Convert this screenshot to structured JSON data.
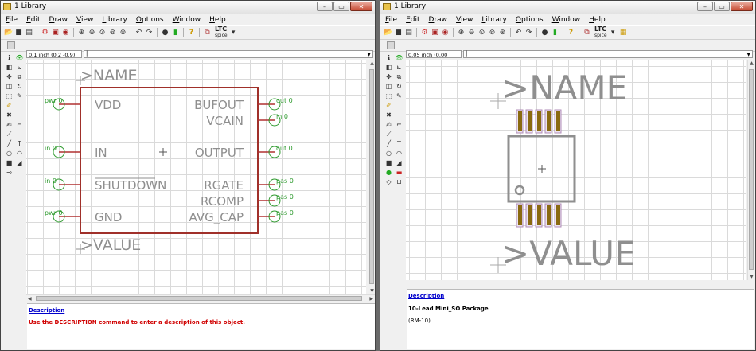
{
  "colors": {
    "grid": "#dadada",
    "outline": "#a0302a",
    "pin": "#b03030",
    "pin_circle": "#2e9a2e",
    "text_gray": "#8f8f8f",
    "pad": "#8a6a10",
    "link": "#0000cc",
    "warn": "#d00000"
  },
  "left_window": {
    "title": "1 Library",
    "coord": "0.1 inch (0.2 -0.9)",
    "cmd": "|",
    "symbol": {
      "name_label": ">NAME",
      "value_label": ">VALUE",
      "left_pins": [
        {
          "label": "VDD",
          "net": "pwr 0"
        },
        {
          "label": "IN",
          "net": "in 0"
        },
        {
          "label": "SHUTDOWN",
          "net": "in 0",
          "overline": true
        },
        {
          "label": "GND",
          "net": "pwr 0"
        }
      ],
      "right_pins": [
        {
          "label": "BUFOUT",
          "net": "out 0"
        },
        {
          "label": "VCAIN",
          "net": "in 0"
        },
        {
          "label": "OUTPUT",
          "net": "out 0"
        },
        {
          "label": "RGATE",
          "net": "pas 0"
        },
        {
          "label": "RCOMP",
          "net": "pas 0"
        },
        {
          "label": "AVG_CAP",
          "net": "pas 0"
        }
      ]
    },
    "description": {
      "heading": "Description",
      "text": "Use the DESCRIPTION command to enter a description of this object."
    }
  },
  "right_window": {
    "title": "1 Library",
    "coord": "0.05 inch (0.00 0.20)",
    "cmd": "|",
    "package": {
      "name_label": ">NAME",
      "value_label": ">VALUE",
      "pads_top": 5,
      "pads_bottom": 5
    },
    "description": {
      "heading": "Description",
      "title": "10-Lead Mini_SO Package",
      "subtitle": "(RM-10)"
    }
  },
  "menus": [
    "File",
    "Edit",
    "Draw",
    "View",
    "Library",
    "Options",
    "Window",
    "Help"
  ],
  "toolbar_icons": [
    "open-icon",
    "save-icon",
    "print-icon",
    "cam-icon",
    "script-icon",
    "run-icon",
    "zoom-in-icon",
    "zoom-out-icon",
    "zoom-redraw-icon",
    "zoom-fit-icon",
    "zoom-select-icon",
    "undo-icon",
    "redo-icon",
    "stop-icon",
    "go-icon",
    "help-icon",
    "ltspice-icon"
  ],
  "ltc_label": "LTC",
  "ltc_sub": "spice"
}
